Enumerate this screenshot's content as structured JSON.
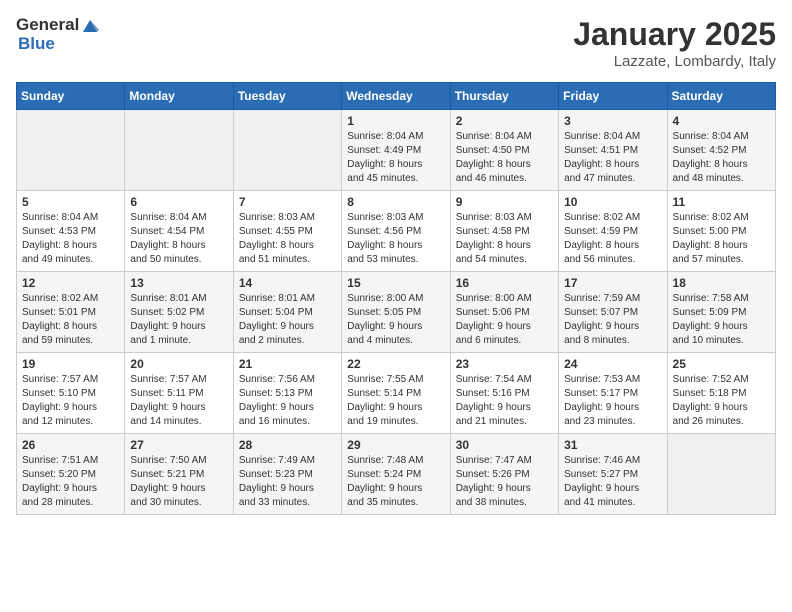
{
  "logo": {
    "general": "General",
    "blue": "Blue"
  },
  "title": "January 2025",
  "subtitle": "Lazzate, Lombardy, Italy",
  "headers": [
    "Sunday",
    "Monday",
    "Tuesday",
    "Wednesday",
    "Thursday",
    "Friday",
    "Saturday"
  ],
  "weeks": [
    [
      {
        "day": "",
        "info": ""
      },
      {
        "day": "",
        "info": ""
      },
      {
        "day": "",
        "info": ""
      },
      {
        "day": "1",
        "info": "Sunrise: 8:04 AM\nSunset: 4:49 PM\nDaylight: 8 hours\nand 45 minutes."
      },
      {
        "day": "2",
        "info": "Sunrise: 8:04 AM\nSunset: 4:50 PM\nDaylight: 8 hours\nand 46 minutes."
      },
      {
        "day": "3",
        "info": "Sunrise: 8:04 AM\nSunset: 4:51 PM\nDaylight: 8 hours\nand 47 minutes."
      },
      {
        "day": "4",
        "info": "Sunrise: 8:04 AM\nSunset: 4:52 PM\nDaylight: 8 hours\nand 48 minutes."
      }
    ],
    [
      {
        "day": "5",
        "info": "Sunrise: 8:04 AM\nSunset: 4:53 PM\nDaylight: 8 hours\nand 49 minutes."
      },
      {
        "day": "6",
        "info": "Sunrise: 8:04 AM\nSunset: 4:54 PM\nDaylight: 8 hours\nand 50 minutes."
      },
      {
        "day": "7",
        "info": "Sunrise: 8:03 AM\nSunset: 4:55 PM\nDaylight: 8 hours\nand 51 minutes."
      },
      {
        "day": "8",
        "info": "Sunrise: 8:03 AM\nSunset: 4:56 PM\nDaylight: 8 hours\nand 53 minutes."
      },
      {
        "day": "9",
        "info": "Sunrise: 8:03 AM\nSunset: 4:58 PM\nDaylight: 8 hours\nand 54 minutes."
      },
      {
        "day": "10",
        "info": "Sunrise: 8:02 AM\nSunset: 4:59 PM\nDaylight: 8 hours\nand 56 minutes."
      },
      {
        "day": "11",
        "info": "Sunrise: 8:02 AM\nSunset: 5:00 PM\nDaylight: 8 hours\nand 57 minutes."
      }
    ],
    [
      {
        "day": "12",
        "info": "Sunrise: 8:02 AM\nSunset: 5:01 PM\nDaylight: 8 hours\nand 59 minutes."
      },
      {
        "day": "13",
        "info": "Sunrise: 8:01 AM\nSunset: 5:02 PM\nDaylight: 9 hours\nand 1 minute."
      },
      {
        "day": "14",
        "info": "Sunrise: 8:01 AM\nSunset: 5:04 PM\nDaylight: 9 hours\nand 2 minutes."
      },
      {
        "day": "15",
        "info": "Sunrise: 8:00 AM\nSunset: 5:05 PM\nDaylight: 9 hours\nand 4 minutes."
      },
      {
        "day": "16",
        "info": "Sunrise: 8:00 AM\nSunset: 5:06 PM\nDaylight: 9 hours\nand 6 minutes."
      },
      {
        "day": "17",
        "info": "Sunrise: 7:59 AM\nSunset: 5:07 PM\nDaylight: 9 hours\nand 8 minutes."
      },
      {
        "day": "18",
        "info": "Sunrise: 7:58 AM\nSunset: 5:09 PM\nDaylight: 9 hours\nand 10 minutes."
      }
    ],
    [
      {
        "day": "19",
        "info": "Sunrise: 7:57 AM\nSunset: 5:10 PM\nDaylight: 9 hours\nand 12 minutes."
      },
      {
        "day": "20",
        "info": "Sunrise: 7:57 AM\nSunset: 5:11 PM\nDaylight: 9 hours\nand 14 minutes."
      },
      {
        "day": "21",
        "info": "Sunrise: 7:56 AM\nSunset: 5:13 PM\nDaylight: 9 hours\nand 16 minutes."
      },
      {
        "day": "22",
        "info": "Sunrise: 7:55 AM\nSunset: 5:14 PM\nDaylight: 9 hours\nand 19 minutes."
      },
      {
        "day": "23",
        "info": "Sunrise: 7:54 AM\nSunset: 5:16 PM\nDaylight: 9 hours\nand 21 minutes."
      },
      {
        "day": "24",
        "info": "Sunrise: 7:53 AM\nSunset: 5:17 PM\nDaylight: 9 hours\nand 23 minutes."
      },
      {
        "day": "25",
        "info": "Sunrise: 7:52 AM\nSunset: 5:18 PM\nDaylight: 9 hours\nand 26 minutes."
      }
    ],
    [
      {
        "day": "26",
        "info": "Sunrise: 7:51 AM\nSunset: 5:20 PM\nDaylight: 9 hours\nand 28 minutes."
      },
      {
        "day": "27",
        "info": "Sunrise: 7:50 AM\nSunset: 5:21 PM\nDaylight: 9 hours\nand 30 minutes."
      },
      {
        "day": "28",
        "info": "Sunrise: 7:49 AM\nSunset: 5:23 PM\nDaylight: 9 hours\nand 33 minutes."
      },
      {
        "day": "29",
        "info": "Sunrise: 7:48 AM\nSunset: 5:24 PM\nDaylight: 9 hours\nand 35 minutes."
      },
      {
        "day": "30",
        "info": "Sunrise: 7:47 AM\nSunset: 5:26 PM\nDaylight: 9 hours\nand 38 minutes."
      },
      {
        "day": "31",
        "info": "Sunrise: 7:46 AM\nSunset: 5:27 PM\nDaylight: 9 hours\nand 41 minutes."
      },
      {
        "day": "",
        "info": ""
      }
    ]
  ]
}
